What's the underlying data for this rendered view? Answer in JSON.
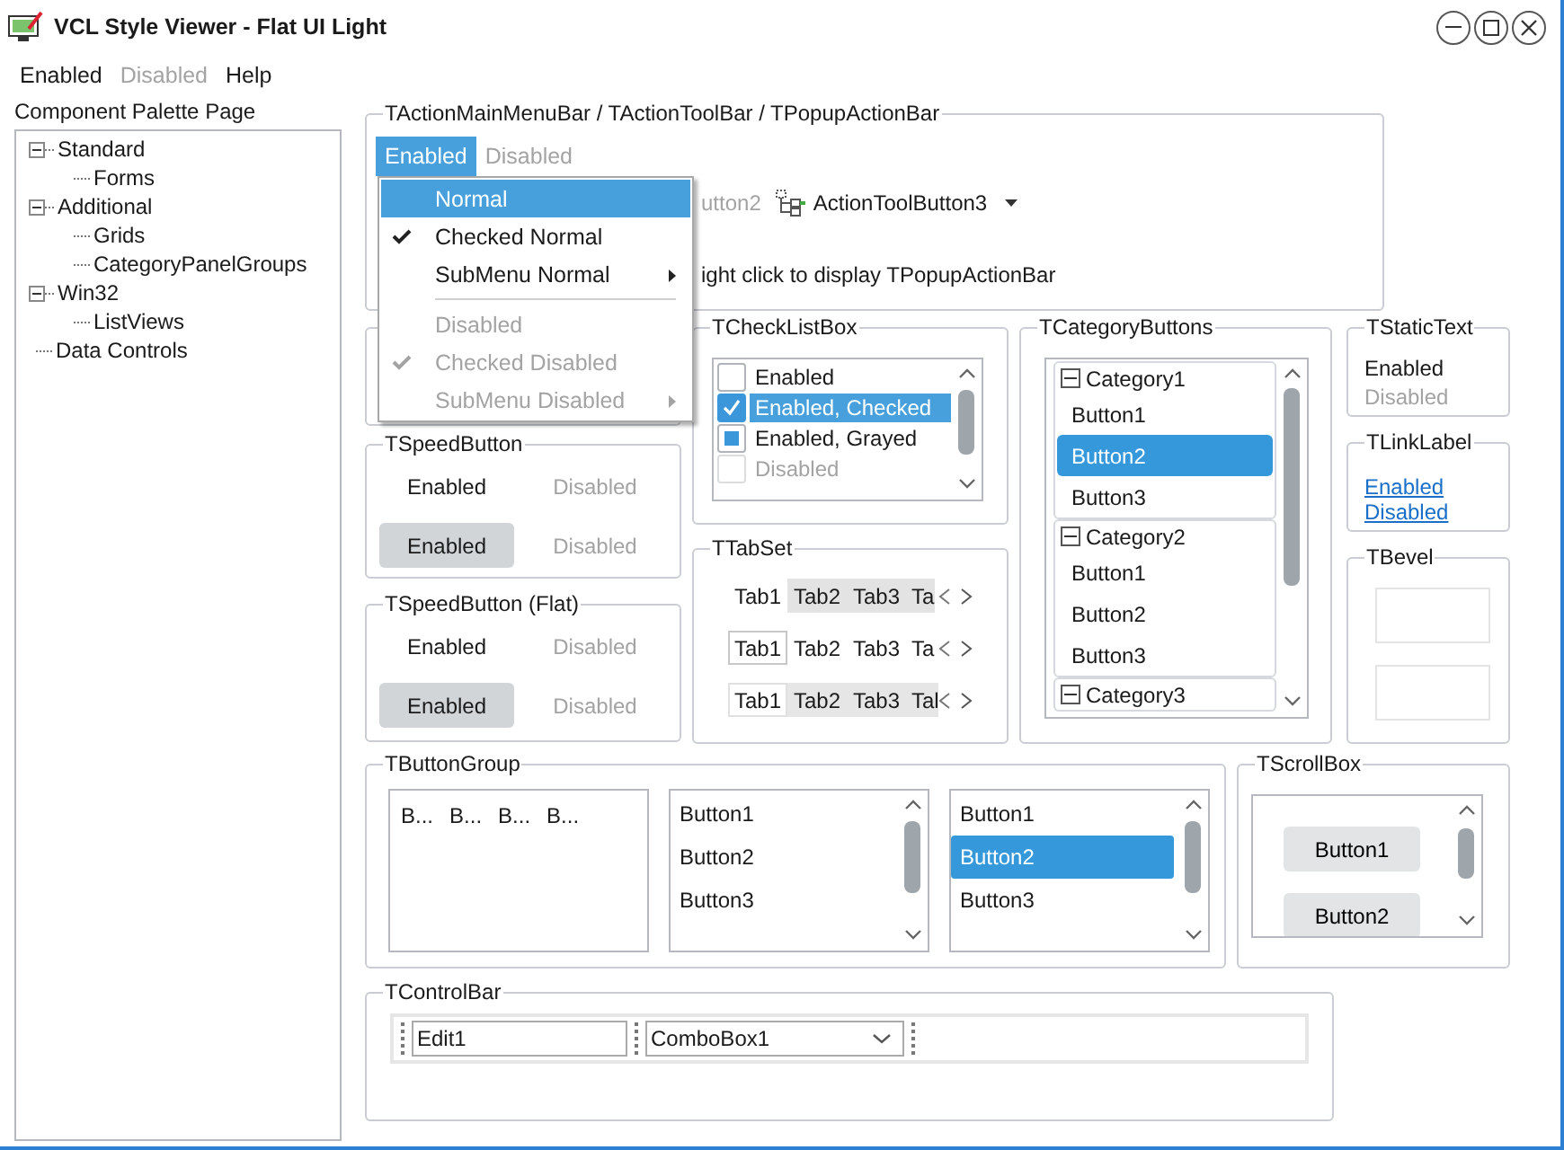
{
  "window": {
    "title": "VCL Style Viewer - Flat UI Light"
  },
  "menu_bar": [
    {
      "label": "Enabled",
      "disabled": false
    },
    {
      "label": "Disabled",
      "disabled": true
    },
    {
      "label": "Help",
      "disabled": false
    }
  ],
  "palette": {
    "label": "Component Palette Page",
    "tree": [
      {
        "label": "Standard",
        "expanded": true,
        "children": [
          {
            "label": "Forms"
          }
        ]
      },
      {
        "label": "Additional",
        "expanded": true,
        "children": [
          {
            "label": "Grids"
          },
          {
            "label": "CategoryPanelGroups"
          }
        ]
      },
      {
        "label": "Win32",
        "expanded": true,
        "children": [
          {
            "label": "ListViews"
          }
        ]
      },
      {
        "label": "Data Controls"
      }
    ]
  },
  "action_bar": {
    "title": "TActionMainMenuBar / TActionToolBar / TPopupActionBar",
    "menu": [
      {
        "label": "Enabled",
        "selected": true,
        "disabled": false
      },
      {
        "label": "Disabled",
        "selected": false,
        "disabled": true
      }
    ],
    "toolbar": [
      {
        "kind": "text",
        "label": "utton2",
        "disabled": true,
        "dropdown": false
      },
      {
        "kind": "icon_text",
        "label": "ActionToolButton3",
        "disabled": false,
        "dropdown": true
      }
    ],
    "hint": "ight click to display TPopupActionBar",
    "popup": [
      {
        "kind": "item",
        "label": "Normal",
        "selected": true,
        "checked": false,
        "disabled": false,
        "submenu": false
      },
      {
        "kind": "item",
        "label": "Checked Normal",
        "selected": false,
        "checked": true,
        "disabled": false,
        "submenu": false
      },
      {
        "kind": "item",
        "label": "SubMenu Normal",
        "selected": false,
        "checked": false,
        "disabled": false,
        "submenu": true
      },
      {
        "kind": "separator"
      },
      {
        "kind": "item",
        "label": "Disabled",
        "selected": false,
        "checked": false,
        "disabled": true,
        "submenu": false
      },
      {
        "kind": "item",
        "label": "Checked Disabled",
        "selected": false,
        "checked": true,
        "disabled": true,
        "submenu": false
      },
      {
        "kind": "item",
        "label": "SubMenu Disabled",
        "selected": false,
        "checked": false,
        "disabled": true,
        "submenu": true
      }
    ]
  },
  "speed_button_groups": [
    {
      "title": "TSpeedButton",
      "buttons": [
        {
          "label": "Enabled",
          "disabled": false,
          "down": false
        },
        {
          "label": "Disabled",
          "disabled": true,
          "down": false
        },
        {
          "label": "Enabled",
          "disabled": false,
          "down": true
        },
        {
          "label": "Disabled",
          "disabled": true,
          "down": false
        }
      ]
    },
    {
      "title": "TSpeedButton (Flat)",
      "buttons": [
        {
          "label": "Enabled",
          "disabled": false,
          "down": false
        },
        {
          "label": "Disabled",
          "disabled": true,
          "down": false
        },
        {
          "label": "Enabled",
          "disabled": false,
          "down": true
        },
        {
          "label": "Disabled",
          "disabled": true,
          "down": false
        }
      ]
    }
  ],
  "check_list": {
    "title": "TCheckListBox",
    "items": [
      {
        "label": "Enabled",
        "checked": false,
        "grayed": false,
        "disabled": false,
        "selected": false
      },
      {
        "label": "Enabled, Checked",
        "checked": true,
        "grayed": false,
        "disabled": false,
        "selected": true
      },
      {
        "label": "Enabled, Grayed",
        "checked": false,
        "grayed": true,
        "disabled": false,
        "selected": false
      },
      {
        "label": "Disabled",
        "checked": false,
        "grayed": false,
        "disabled": true,
        "selected": false
      }
    ]
  },
  "tab_set": {
    "title": "TTabSet",
    "rows": [
      {
        "kind": "tabs",
        "tabs": [
          {
            "label": "Tab1",
            "selected": true
          },
          {
            "label": "Tab2",
            "selected": false
          },
          {
            "label": "Tab3",
            "selected": false
          },
          {
            "label": "Ta",
            "selected": false
          }
        ]
      },
      {
        "kind": "line",
        "tabs": [
          {
            "label": "Tab1",
            "selected": true
          },
          {
            "label": "Tab2",
            "selected": false
          },
          {
            "label": "Tab3",
            "selected": false
          },
          {
            "label": "Ta",
            "selected": false
          }
        ]
      },
      {
        "kind": "flat",
        "tabs": [
          {
            "label": "Tab1",
            "selected": true
          },
          {
            "label": "Tab2",
            "selected": false
          },
          {
            "label": "Tab3",
            "selected": false
          },
          {
            "label": "Tal",
            "selected": false
          }
        ]
      }
    ]
  },
  "category_buttons": {
    "title": "TCategoryButtons",
    "categories": [
      {
        "label": "Category1",
        "expanded": true,
        "buttons": [
          {
            "label": "Button1",
            "selected": false
          },
          {
            "label": "Button2",
            "selected": true
          },
          {
            "label": "Button3",
            "selected": false
          }
        ]
      },
      {
        "label": "Category2",
        "expanded": true,
        "buttons": [
          {
            "label": "Button1",
            "selected": false
          },
          {
            "label": "Button2",
            "selected": false
          },
          {
            "label": "Button3",
            "selected": false
          }
        ]
      },
      {
        "label": "Category3",
        "expanded": true
      }
    ]
  },
  "static_text": {
    "title": "TStaticText",
    "items": [
      {
        "label": "Enabled",
        "disabled": false
      },
      {
        "label": "Disabled",
        "disabled": true
      }
    ]
  },
  "link_label": {
    "title": "TLinkLabel",
    "links": [
      "Enabled",
      "Disabled"
    ]
  },
  "bevel": {
    "title": "TBevel"
  },
  "button_group": {
    "title": "TButtonGroup",
    "groups": [
      {
        "kind": "grid",
        "buttons": [
          {
            "label": "B...",
            "selected": false
          },
          {
            "label": "B...",
            "selected": false
          },
          {
            "label": "B...",
            "selected": false
          },
          {
            "label": "B...",
            "selected": false
          }
        ]
      },
      {
        "kind": "list",
        "buttons": [
          {
            "label": "Button1",
            "selected": false
          },
          {
            "label": "Button2",
            "selected": false
          },
          {
            "label": "Button3",
            "selected": false
          }
        ]
      },
      {
        "kind": "list",
        "buttons": [
          {
            "label": "Button1",
            "selected": false
          },
          {
            "label": "Button2",
            "selected": true
          },
          {
            "label": "Button3",
            "selected": false
          }
        ]
      }
    ]
  },
  "scroll_box": {
    "title": "TScrollBox",
    "buttons": [
      "Button1",
      "Button2"
    ]
  },
  "control_bar": {
    "title": "TControlBar",
    "edit": {
      "value": "Edit1"
    },
    "combo": {
      "value": "ComboBox1"
    }
  }
}
